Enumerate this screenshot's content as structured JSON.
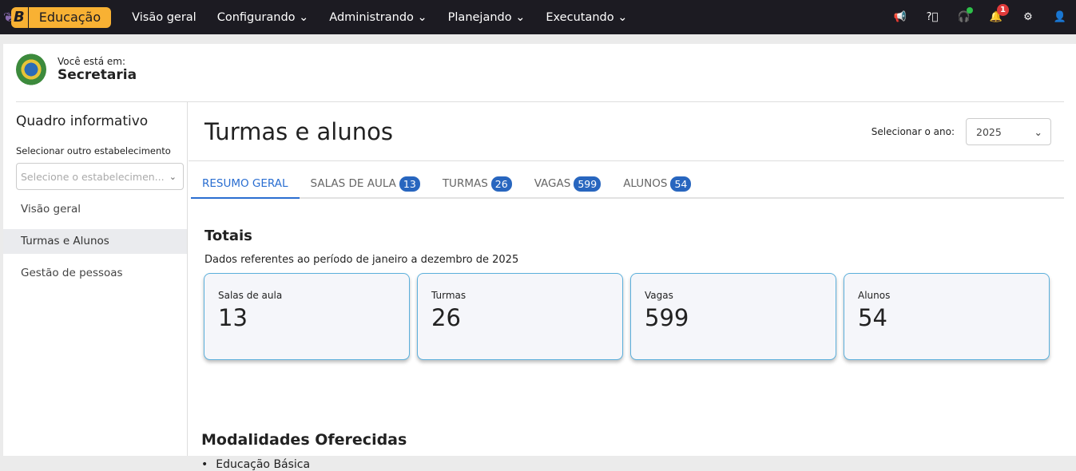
{
  "topbar": {
    "logo_letter": "B",
    "app_name": "Educação",
    "nav": [
      "Visão geral",
      "Configurando",
      "Administrando",
      "Planejando",
      "Executando"
    ],
    "notifications_count": "1"
  },
  "header": {
    "location_label": "Você está em:",
    "location": "Secretaria"
  },
  "sidebar": {
    "title": "Quadro informativo",
    "select_label": "Selecionar outro estabelecimento",
    "select_placeholder": "Selecione o estabelecimen...",
    "items": [
      {
        "label": "Visão geral"
      },
      {
        "label": "Turmas e Alunos",
        "active": true
      },
      {
        "label": "Gestão de pessoas"
      }
    ]
  },
  "main": {
    "title": "Turmas e alunos",
    "year_label": "Selecionar o ano:",
    "year": "2025",
    "tabs": [
      {
        "label": "RESUMO GERAL"
      },
      {
        "label": "SALAS DE AULA",
        "count": "13"
      },
      {
        "label": "TURMAS",
        "count": "26"
      },
      {
        "label": "VAGAS",
        "count": "599"
      },
      {
        "label": "ALUNOS",
        "count": "54"
      }
    ],
    "totals_title": "Totais",
    "totals_subtitle": "Dados referentes ao período de janeiro a dezembro de 2025",
    "cards": [
      {
        "label": "Salas de aula",
        "value": "13"
      },
      {
        "label": "Turmas",
        "value": "26"
      },
      {
        "label": "Vagas",
        "value": "599"
      },
      {
        "label": "Alunos",
        "value": "54"
      }
    ],
    "modalities_title": "Modalidades Oferecidas",
    "modalities": [
      "Educação Básica"
    ]
  },
  "colors": {
    "topbar": "#1c1b22",
    "brand": "#f8b133",
    "accent": "#2a6ed1",
    "badge": "#2866bf"
  }
}
